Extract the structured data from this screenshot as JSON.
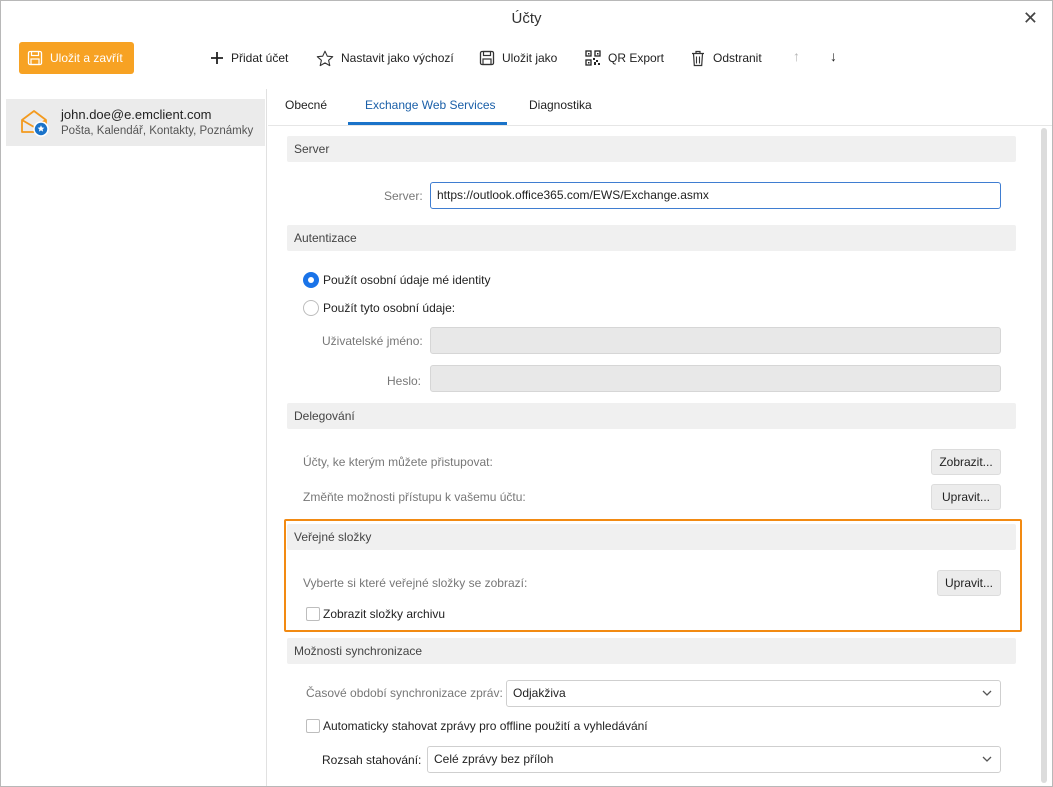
{
  "window": {
    "title": "Účty",
    "close_glyph": "✕"
  },
  "toolbar": {
    "save_close": "Uložit a zavřít",
    "add_account": "Přidat účet",
    "set_default": "Nastavit jako výchozí",
    "save_as": "Uložit jako",
    "qr_export": "QR Export",
    "remove": "Odstranit",
    "move_up": "↑",
    "move_down": "↓"
  },
  "account": {
    "email": "john.doe@e.emclient.com",
    "services": "Pošta, Kalendář, Kontakty, Poznámky"
  },
  "tabs": [
    {
      "label": "Obecné"
    },
    {
      "label": "Exchange Web Services",
      "active": true
    },
    {
      "label": "Diagnostika"
    }
  ],
  "server": {
    "header": "Server",
    "label": "Server:",
    "value": "https://outlook.office365.com/EWS/Exchange.asmx"
  },
  "auth": {
    "header": "Autentizace",
    "option_own": "Použít osobní údaje mé identity",
    "option_custom": "Použít tyto osobní údaje:",
    "username_label": "Uživatelské jméno:",
    "password_label": "Heslo:",
    "selected": "own"
  },
  "delegation": {
    "header": "Delegování",
    "accessible_label": "Účty, ke kterým můžete přistupovat:",
    "accessible_button": "Zobrazit...",
    "change_access_label": "Změňte možnosti přístupu k vašemu účtu:",
    "change_access_button": "Upravit..."
  },
  "public_folders": {
    "header": "Veřejné složky",
    "choose_label": "Vyberte si které veřejné složky se zobrazí:",
    "choose_button": "Upravit...",
    "show_archive": "Zobrazit složky archivu",
    "show_archive_checked": false
  },
  "sync": {
    "header": "Možnosti synchronizace",
    "period_label": "Časové období synchronizace zpráv:",
    "period_value": "Odjakživa",
    "auto_download": "Automaticky stahovat zprávy pro offline použití a vyhledávání",
    "auto_download_checked": false,
    "range_label": "Rozsah stahování:",
    "range_value": "Celé zprávy bez příloh"
  },
  "colors": {
    "accent": "#f7a223",
    "tab_active": "#1a73c9",
    "highlight": "#f28a12",
    "radio_on": "#1a73e8"
  }
}
